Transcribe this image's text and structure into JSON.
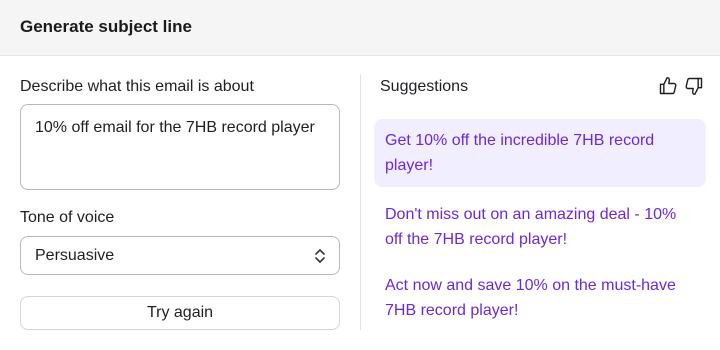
{
  "header": {
    "title": "Generate subject line"
  },
  "form": {
    "describe_label": "Describe what this email is about",
    "describe_value": "10% off email for the 7HB record player",
    "tone_label": "Tone of voice",
    "tone_value": "Persuasive",
    "try_again_label": "Try again"
  },
  "suggestions": {
    "title": "Suggestions",
    "items": [
      {
        "text": "Get 10% off the incredible 7HB record player!",
        "selected": true
      },
      {
        "text": "Don't miss out on an amazing deal - 10% off the 7HB record player!",
        "selected": false
      },
      {
        "text": "Act now and save 10% on the must-have 7HB record player!",
        "selected": false
      }
    ]
  },
  "icons": {
    "select": "chevron-up-down-icon",
    "like": "thumbs-up-icon",
    "dislike": "thumbs-down-icon"
  },
  "colors": {
    "accent_text": "#6d28d9",
    "selected_bg": "#f1efff",
    "header_bg": "#f5f5f5"
  }
}
